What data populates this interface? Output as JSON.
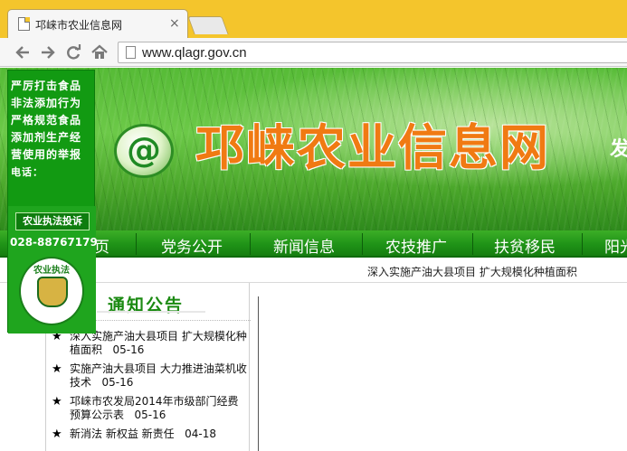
{
  "browser": {
    "tab_title": "邛崃市农业信息网",
    "tab_close": "×",
    "url": "www.qlagr.gov.cn"
  },
  "banner": {
    "logo_text": "@",
    "title": "邛崃农业信息网",
    "right_text": "发"
  },
  "nav": {
    "items": [
      "页",
      "党务公开",
      "新闻信息",
      "农技推广",
      "扶贫移民",
      "阳光"
    ]
  },
  "marquee": "深入实施产油大县项目 扩大规模化种植面积",
  "notices": {
    "title": "通知公告",
    "items": [
      {
        "text": "深入实施产油大县项目 扩大规模化种植面积",
        "date": "05-16"
      },
      {
        "text": "实施产油大县项目 大力推进油菜机收技术",
        "date": "05-16"
      },
      {
        "text": "邛崃市农发局2014年市级部门经费预算公示表",
        "date": "05-16"
      },
      {
        "text": "新消法 新权益 新责任",
        "date": "04-18"
      }
    ]
  },
  "float_ad": {
    "line1": "严厉打击食品",
    "line2": "非法添加行为",
    "line3": "严格规范食品",
    "line4": "添加剂生产经",
    "line5": "营使用的举报",
    "line6": "电话：",
    "button": "农业执法投诉",
    "phone": "028-88767179",
    "badge_text": "农业执法"
  },
  "colors": {
    "chrome_accent": "#f4c52c",
    "site_green": "#1f9317",
    "title_orange": "#f07a13"
  }
}
